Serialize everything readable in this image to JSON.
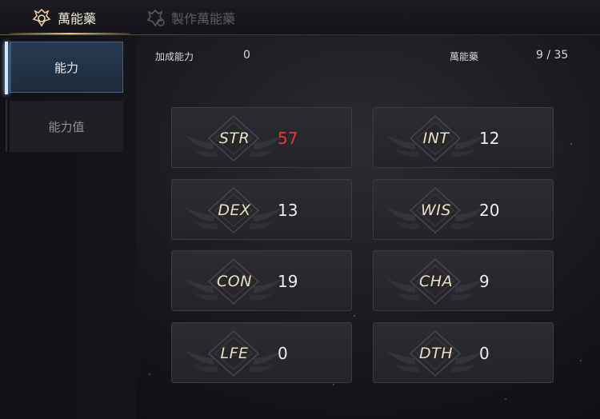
{
  "tabs": [
    {
      "label": "萬能藥",
      "active": true,
      "icon": "elixir-icon"
    },
    {
      "label": "製作萬能藥",
      "active": false,
      "icon": "craft-elixir-icon"
    }
  ],
  "sidebar": {
    "items": [
      {
        "label": "能力",
        "selected": true
      },
      {
        "label": "能力值",
        "selected": false
      }
    ]
  },
  "info": {
    "bonus_label": "加成能力",
    "bonus_value": "0",
    "elixir_label": "萬能藥",
    "elixir_value": "9 / 35"
  },
  "stats": [
    {
      "name": "STR",
      "value": "57",
      "highlight": true
    },
    {
      "name": "INT",
      "value": "12",
      "highlight": false
    },
    {
      "name": "DEX",
      "value": "13",
      "highlight": false
    },
    {
      "name": "WIS",
      "value": "20",
      "highlight": false
    },
    {
      "name": "CON",
      "value": "19",
      "highlight": false
    },
    {
      "name": "CHA",
      "value": "9",
      "highlight": false
    },
    {
      "name": "LFE",
      "value": "0",
      "highlight": false
    },
    {
      "name": "DTH",
      "value": "0",
      "highlight": false
    }
  ],
  "colors": {
    "accent_gold": "#e7c98a",
    "highlight_red": "#e5332e",
    "selected_blue": "#283a52"
  }
}
